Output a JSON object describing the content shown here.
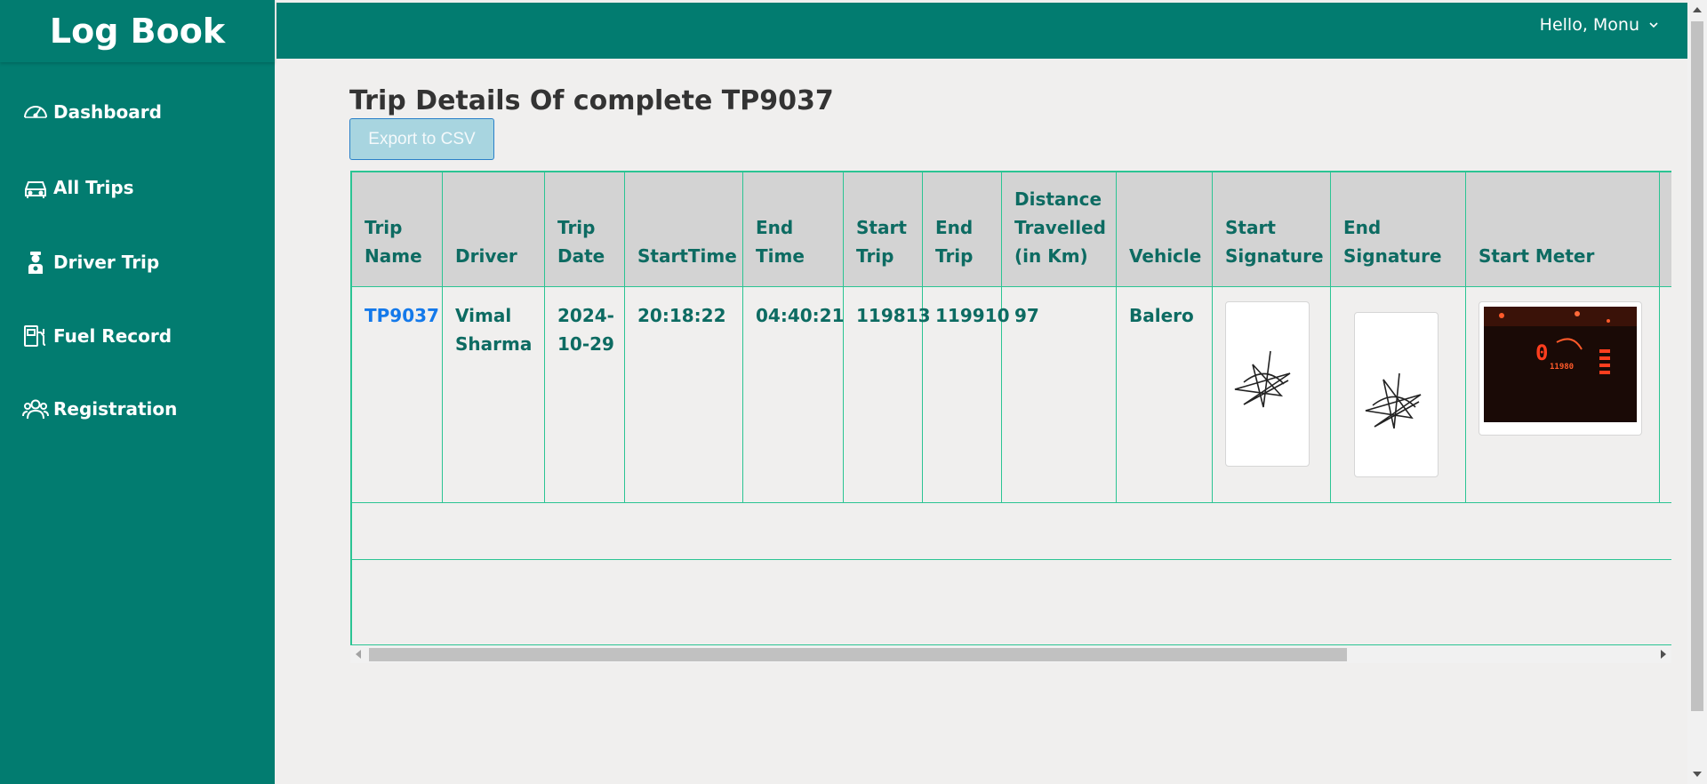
{
  "app": {
    "brand": "Log Book"
  },
  "sidebar": {
    "items": [
      {
        "label": "Dashboard",
        "icon": "speedometer-icon"
      },
      {
        "label": "All Trips",
        "icon": "car-icon"
      },
      {
        "label": "Driver Trip",
        "icon": "driver-icon"
      },
      {
        "label": "Fuel Record",
        "icon": "fuel-station-icon"
      },
      {
        "label": "Registration",
        "icon": "users-icon"
      }
    ]
  },
  "header": {
    "greeting": "Hello, Monu",
    "dropdown_icon": "chevron-down-icon"
  },
  "main": {
    "title": "Trip Details Of complete TP9037",
    "export_label": "Export to CSV",
    "table": {
      "columns": [
        "Trip Name",
        "Driver",
        "Trip Date",
        "StartTime",
        "End Time",
        "Start Trip",
        "End Trip",
        "Distance Travelled (in Km)",
        "Vehicle",
        "Start Signature",
        "End Signature",
        "Start Meter"
      ],
      "rows": [
        {
          "trip_name": "TP9037",
          "driver": "Vimal Sharma",
          "trip_date": "2024-10-29",
          "start_time": "20:18:22",
          "end_time": "04:40:21",
          "start_trip": "119813",
          "end_trip": "119910",
          "distance": "97",
          "vehicle": "Balero",
          "start_signature": "signature-image",
          "end_signature": "signature-image",
          "start_meter": "odometer-photo"
        }
      ]
    }
  },
  "colors": {
    "primary": "#027c70",
    "table_border": "#2bc493",
    "link": "#1479ea",
    "header_bg": "#d3d3d3"
  }
}
